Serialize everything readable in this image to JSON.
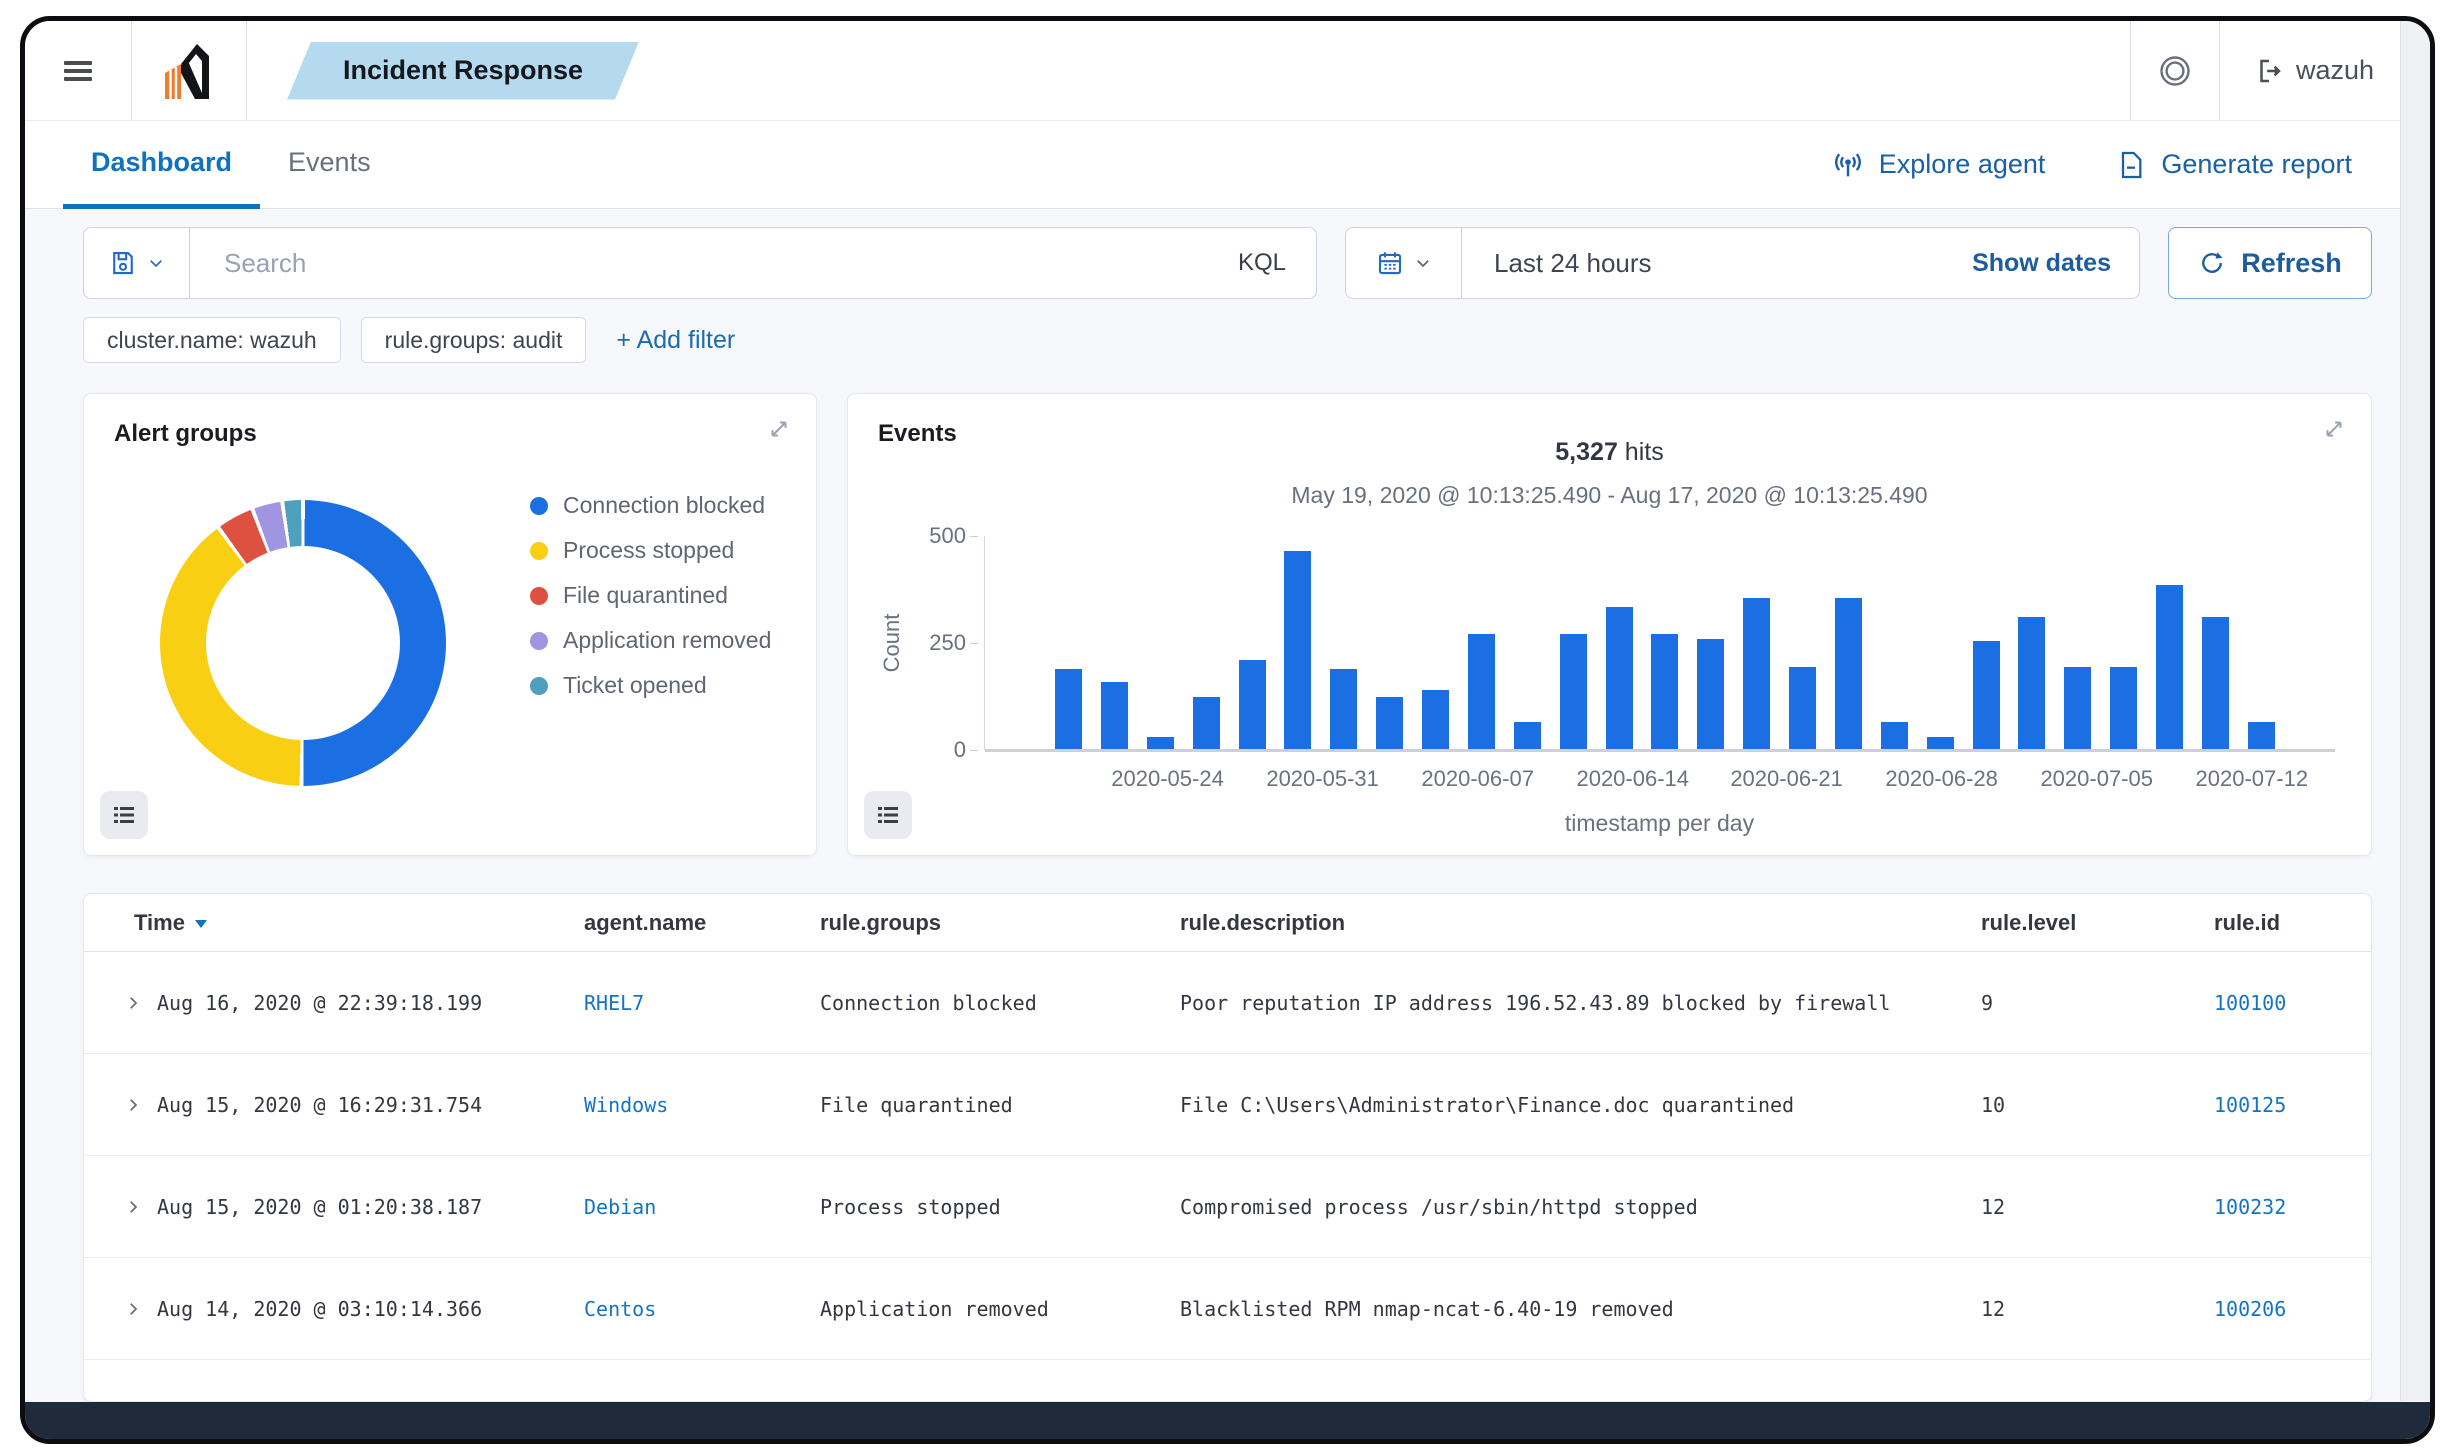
{
  "topbar": {
    "breadcrumb": "Incident Response",
    "user": "wazuh"
  },
  "tabs": [
    {
      "label": "Dashboard",
      "active": true
    },
    {
      "label": "Events",
      "active": false
    }
  ],
  "actions": {
    "explore_agent": "Explore agent",
    "generate_report": "Generate report"
  },
  "search": {
    "placeholder": "Search",
    "query_language": "KQL",
    "time_range": "Last 24 hours",
    "show_dates_label": "Show dates",
    "refresh_label": "Refresh"
  },
  "filters": {
    "pills": [
      "cluster.name: wazuh",
      "rule.groups: audit"
    ],
    "add_filter_label": "+ Add filter"
  },
  "panels": {
    "alert_groups_title": "Alert groups",
    "events_title": "Events"
  },
  "chart_data": [
    {
      "type": "pie",
      "title": "Alert groups",
      "donut": true,
      "legend_position": "right",
      "categories": [
        "Connection blocked",
        "Process stopped",
        "File quarantined",
        "Application removed",
        "Ticket opened"
      ],
      "values_percent": [
        50.2,
        39.7,
        3.9,
        3.0,
        1.9
      ],
      "colors": [
        "#1c6fe2",
        "#f8cf13",
        "#de5140",
        "#a095e0",
        "#4fa0be"
      ]
    },
    {
      "type": "bar",
      "hits_count": "5,327",
      "hits_suffix": " hits",
      "subtitle": "May 19, 2020 @ 10:13:25.490 - Aug 17, 2020 @ 10:13:25.490",
      "xlabel": "timestamp per day",
      "ylabel": "Count",
      "ylim": [
        0,
        500
      ],
      "yticks": [
        0,
        250,
        500
      ],
      "grid": false,
      "bar_color": "#1c6fe2",
      "values": [
        190,
        160,
        30,
        125,
        210,
        465,
        190,
        125,
        140,
        270,
        65,
        270,
        335,
        270,
        260,
        355,
        195,
        355,
        65,
        30,
        255,
        310,
        195,
        195,
        385,
        310,
        65
      ],
      "x_tick_labels": [
        "2020-05-24",
        "2020-05-31",
        "2020-06-07",
        "2020-06-14",
        "2020-06-21",
        "2020-06-28",
        "2020-07-05",
        "2020-07-12"
      ],
      "x_tick_positions_pct": [
        9.3,
        22.0,
        34.7,
        47.4,
        60.0,
        72.7,
        85.4,
        98.1
      ]
    }
  ],
  "table": {
    "columns": [
      "Time",
      "agent.name",
      "rule.groups",
      "rule.description",
      "rule.level",
      "rule.id"
    ],
    "sorted_column": "Time",
    "rows": [
      {
        "time": "Aug 16, 2020 @ 22:39:18.199",
        "agent": "RHEL7",
        "groups": "Connection blocked",
        "description": "Poor reputation IP address 196.52.43.89 blocked by firewall",
        "level": "9",
        "id": "100100"
      },
      {
        "time": "Aug 15, 2020 @ 16:29:31.754",
        "agent": "Windows",
        "groups": "File quarantined",
        "description": "File C:\\Users\\Administrator\\Finance.doc quarantined",
        "level": "10",
        "id": "100125"
      },
      {
        "time": "Aug 15, 2020 @ 01:20:38.187",
        "agent": "Debian",
        "groups": "Process stopped",
        "description": "Compromised process /usr/sbin/httpd stopped",
        "level": "12",
        "id": "100232"
      },
      {
        "time": "Aug 14, 2020 @ 03:10:14.366",
        "agent": "Centos",
        "groups": "Application removed",
        "description": "Blacklisted RPM nmap-ncat-6.40-19 removed",
        "level": "12",
        "id": "100206"
      }
    ]
  },
  "colors": {
    "primary_blue": "#1d5d9e",
    "tab_blue": "#0f72be",
    "link_blue": "#1474c4",
    "bar_blue": "#1c6fe2",
    "breadcrumb_bg": "#b5d9ee",
    "footer_bg": "#1f2a3a"
  }
}
